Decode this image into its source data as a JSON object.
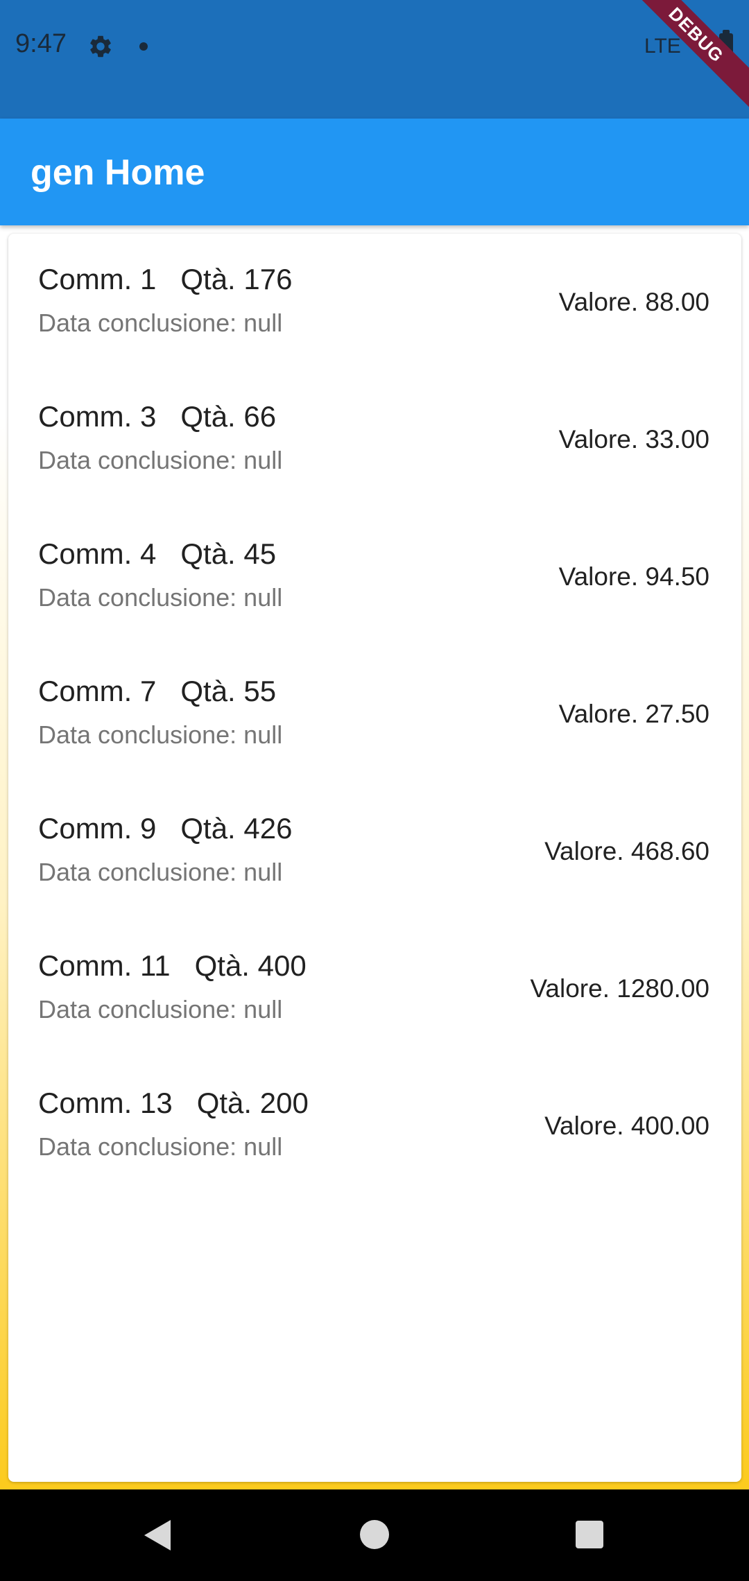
{
  "status_bar": {
    "time": "9:47",
    "network": "LTE"
  },
  "debug_banner": "DEBUG",
  "app_bar": {
    "title": "gen Home"
  },
  "orders": [
    {
      "title": "Comm. 1   Qtà. 176",
      "subtitle": "Data conclusione: null",
      "value": "Valore. 88.00"
    },
    {
      "title": "Comm. 3   Qtà. 66",
      "subtitle": "Data conclusione: null",
      "value": "Valore. 33.00"
    },
    {
      "title": "Comm. 4   Qtà. 45",
      "subtitle": "Data conclusione: null",
      "value": "Valore. 94.50"
    },
    {
      "title": "Comm. 7   Qtà. 55",
      "subtitle": "Data conclusione: null",
      "value": "Valore. 27.50"
    },
    {
      "title": "Comm. 9   Qtà. 426",
      "subtitle": "Data conclusione: null",
      "value": "Valore. 468.60"
    },
    {
      "title": "Comm. 11   Qtà. 400",
      "subtitle": "Data conclusione: null",
      "value": "Valore. 1280.00"
    },
    {
      "title": "Comm. 13   Qtà. 200",
      "subtitle": "Data conclusione: null",
      "value": "Valore. 400.00"
    }
  ],
  "colors": {
    "status_bar": "#1c6fba",
    "app_bar": "#2196f3",
    "debug_ribbon": "#7c1a3a",
    "background_gradient_end": "#fccb1e"
  },
  "icons": {
    "status": [
      "gear-icon",
      "notification-dot-icon",
      "battery-icon"
    ],
    "navigation": [
      "back-icon",
      "home-icon",
      "recents-icon"
    ]
  }
}
